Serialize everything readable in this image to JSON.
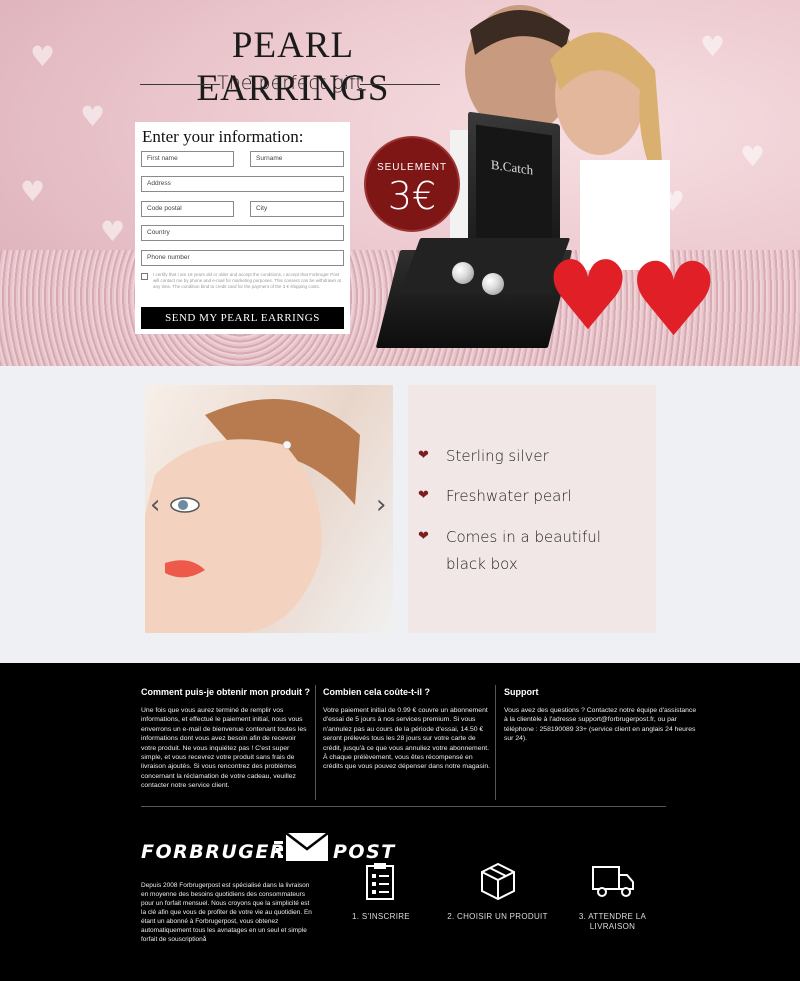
{
  "hero": {
    "title": "PEARL EARRINGS",
    "subtitle": "The perfect gift",
    "box_brand": "B.Catch",
    "price": {
      "label": "SEULEMENT",
      "value": "3€"
    }
  },
  "form": {
    "title": "Enter your information:",
    "placeholders": {
      "first_name": "First name",
      "surname": "Surname",
      "address": "Address",
      "postcode": "Code postal",
      "city": "City",
      "country": "Country",
      "phone": "Phone number"
    },
    "consent_text": "I certify that I am 18 years old or older and accept the conditions, I accept that Forbruger Post will contact me by phone and e-mail for marketing purposes. This consent can be withdrawn at any time. The condition bind to credit card for the payment of the 3 € shipping costs.",
    "submit_label": "SEND MY PEARL EARRINGS"
  },
  "product": {
    "features": [
      "Sterling silver",
      "Freshwater pearl",
      "Comes in a beautiful",
      "black box"
    ]
  },
  "footer": {
    "col1": {
      "title": "Comment puis-je obtenir mon produit ?",
      "text": "Une fois que vous aurez terminé de remplir vos informations, et effectué le paiement initial, nous vous enverrons un e-mail de bienvenue contenant toutes les informations dont vous avez besoin afin de recevoir votre produit. Ne vous inquiétez pas ! C'est super simple, et vous recevrez votre produit sans frais de livraison ajoutés. Si vous rencontrez des problèmes concernant la réclamation de votre cadeau, veuillez contacter notre service client."
    },
    "col2": {
      "title": "Combien cela coûte-t-il ?",
      "text": "Votre paiement initial de 0.99 € couvre un abonnement d'essai de 5 jours à nos services premium. Si vous n'annulez pas au cours de la période d'essai, 14.50 € seront prélevés tous les 28 jours sur votre carte de crédit, jusqu'à ce que vous annuliez votre abonnement. À chaque prélèvement, vous êtes récompensé en crédits que vous pouvez dépenser dans notre magasin."
    },
    "col3": {
      "title": "Support",
      "text": "Vous avez des questions ? Contactez notre équipe d'assistance à la clientèle à l'adresse support@forbrugerpost.fr, ou par téléphone : 258190089 33+ (service client en anglais 24 heures sur 24)."
    },
    "logo_left": "FORBRUGER",
    "logo_right": "POST",
    "about": "Depuis 2008 Forbrugerpost est spécialisé dans la livraison en moyenne des besoins quotidiens des consommateurs pour un forfait mensuel. Nous croyons que la simplicité est la clé afin que vous de profiter de votre vie au quotidien. En étant un abonné à Forbrugerpost, vous obtenez automatiquement tous les avnatages en un seul et simple forfait de souscriptionå",
    "steps": [
      {
        "label": "1. S'INSCRIRE"
      },
      {
        "label": "2. CHOISIR UN PRODUIT"
      },
      {
        "label": "3. ATTENDRE LA LIVRAISON"
      }
    ]
  },
  "colors": {
    "price_bg": "#7e1616",
    "heart": "#e01f27",
    "footer_bg": "#000000",
    "button_bg": "#000000"
  }
}
